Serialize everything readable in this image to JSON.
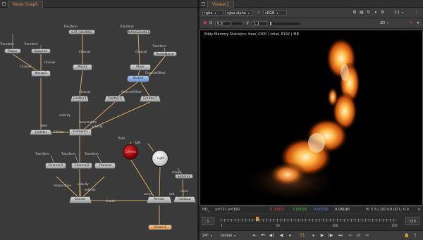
{
  "node_graph": {
    "tab_label": "Node Graph",
    "nodes": {
      "plane": "Plane",
      "sphere1": "Sphere1",
      "merge1": "Merge1",
      "cat_source": "CAT_SOURCE",
      "mask1": "Mask1",
      "mask1_sub": "Mask",
      "mask_source": "MASKSOURCE",
      "mask2": "Mask",
      "mask2_sub": "Mask2",
      "perlin": "PerlinNoise",
      "distort": "Distort",
      "emitter1": "Emitter1",
      "emitter3": "Emitter3",
      "emitter2": "Emitter2",
      "collider": "Collider",
      "element1": "Element1",
      "channel1": "Channel1",
      "channel2": "Channel2",
      "channel3": "Channel",
      "shader": "Shader",
      "shader_sub": "fire",
      "render": "Render",
      "holdout": "Holdout",
      "viewer1": "Viewer1",
      "light": "Light",
      "sphere2": "Sphere2"
    },
    "labels": {
      "transform": "Transform",
      "channel": "Channel",
      "channel_offset": "ChannelOffset",
      "velocity": "velocity",
      "temperature": "temperature",
      "collider_in": "Collider",
      "field": "field",
      "mask": "mask",
      "camera": "Camera",
      "light": "light",
      "scene": "scene",
      "shader": "shader",
      "wdt": "wdt",
      "mesh": "mesh",
      "image": "image",
      "geo": "geo",
      "proxy": "proxy",
      "lights": "lights"
    }
  },
  "viewer": {
    "tab_label": "Viewer1",
    "channels": "rgba",
    "alpha_channel": "rgba.alpha",
    "colorspace": "sRGB",
    "zoom_ratio": "1:1",
    "gain": "0.8",
    "gamma": "1.1",
    "view_mode": "2D",
    "stats_text": "Eddy Memory Statistics: free( 4100 )  total( 8192 ) MB",
    "info": {
      "format": "HD_",
      "coords": "x=727 y=390",
      "r": "0.00057",
      "g": "0.00005",
      "b": "0.00000",
      "a": "0.04190",
      "frame_info": "H:  5 S:1.00 V:0.00  L: 0.0"
    },
    "timeline": {
      "start": "1",
      "end": "150",
      "ticks": [
        "1",
        "50",
        "100",
        "150"
      ],
      "current": "31"
    },
    "playback": {
      "fps": "24\"",
      "mode": "Global",
      "step": "10"
    },
    "colors": {
      "accent": "#e09040",
      "red_value": "#e04040",
      "green_value": "#40c040",
      "blue_value": "#6080ff"
    }
  }
}
